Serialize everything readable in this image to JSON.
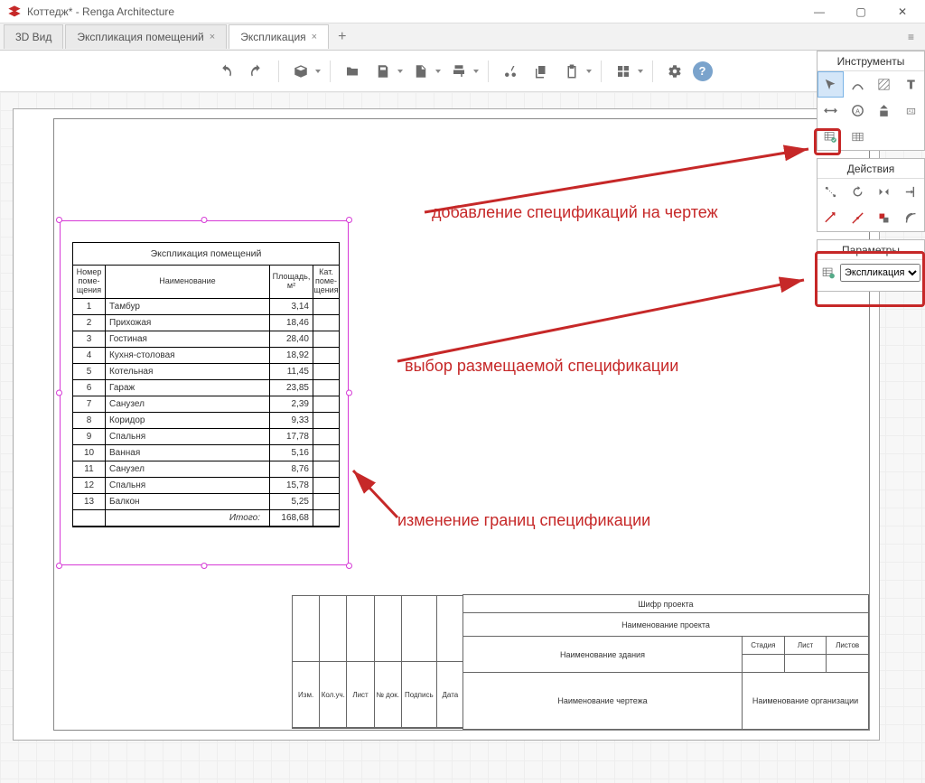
{
  "titlebar": {
    "title": "Коттедж* - Renga Architecture"
  },
  "tabs": {
    "items": [
      {
        "label": "3D Вид",
        "closable": false
      },
      {
        "label": "Экспликация помещений",
        "closable": true
      },
      {
        "label": "Экспликация",
        "closable": true
      }
    ],
    "active_index": 2
  },
  "panels": {
    "tools_title": "Инструменты",
    "actions_title": "Действия",
    "params_title": "Параметры",
    "params_select": "Экспликация"
  },
  "spec": {
    "caption": "Экспликация помещений",
    "columns": {
      "num": "Номер поме-щения",
      "name": "Наименование",
      "area": "Площадь, м²",
      "cat": "Кат. поме-щения"
    },
    "rows": [
      {
        "num": "1",
        "name": "Тамбур",
        "area": "3,14"
      },
      {
        "num": "2",
        "name": "Прихожая",
        "area": "18,46"
      },
      {
        "num": "3",
        "name": "Гостиная",
        "area": "28,40"
      },
      {
        "num": "4",
        "name": "Кухня-столовая",
        "area": "18,92"
      },
      {
        "num": "5",
        "name": "Котельная",
        "area": "11,45"
      },
      {
        "num": "6",
        "name": "Гараж",
        "area": "23,85"
      },
      {
        "num": "7",
        "name": "Санузел",
        "area": "2,39"
      },
      {
        "num": "8",
        "name": "Коридор",
        "area": "9,33"
      },
      {
        "num": "9",
        "name": "Спальня",
        "area": "17,78"
      },
      {
        "num": "10",
        "name": "Ванная",
        "area": "5,16"
      },
      {
        "num": "11",
        "name": "Санузел",
        "area": "8,76"
      },
      {
        "num": "12",
        "name": "Спальня",
        "area": "15,78"
      },
      {
        "num": "13",
        "name": "Балкон",
        "area": "5,25"
      }
    ],
    "footer": {
      "label": "Итого:",
      "total": "168,68"
    }
  },
  "titleblock": {
    "code": "Шифр проекта",
    "project": "Наименование проекта",
    "building": "Наименование здания",
    "drawing": "Наименование чертежа",
    "org": "Наименование организации",
    "stage": "Стадия",
    "sheet": "Лист",
    "sheets": "Листов",
    "left_cols": [
      "Изм.",
      "Кол.уч.",
      "Лист",
      "№ док.",
      "Подпись",
      "Дата"
    ]
  },
  "callouts": {
    "c1": "добавление спецификаций на чертеж",
    "c2": "выбор размещаемой спецификации",
    "c3": "изменение границ спецификации"
  }
}
